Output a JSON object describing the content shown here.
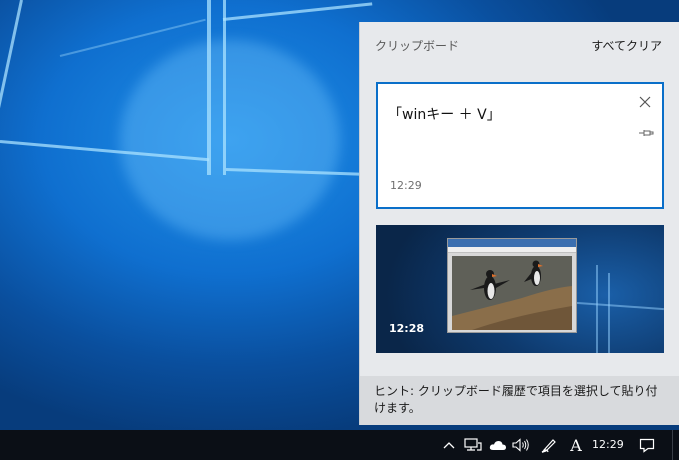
{
  "clipboard": {
    "title": "クリップボード",
    "clear_all": "すべてクリア",
    "items": [
      {
        "text": "「winキー ＋ V」",
        "time": "12:29"
      },
      {
        "time": "12:28"
      }
    ],
    "hint": "ヒント: クリップボード履歴で項目を選択して貼り付けます。"
  },
  "taskbar": {
    "time": "12:29",
    "ime_mode": "A",
    "tray_icons": [
      "chevron-up-icon",
      "network-icon",
      "onedrive-icon",
      "volume-icon",
      "pen-icon",
      "ime-icon",
      "notification-icon"
    ]
  },
  "colors": {
    "accent": "#0a6fc9",
    "taskbar": "#0b0f16",
    "panel": "#e7e9ec"
  }
}
